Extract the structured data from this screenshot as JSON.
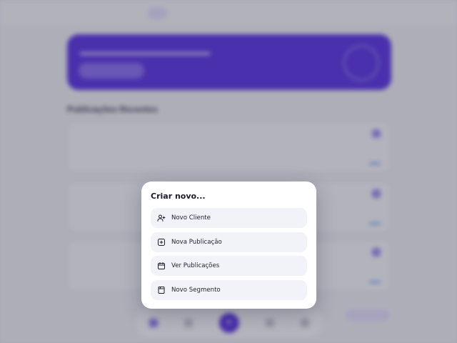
{
  "modal": {
    "title": "Criar novo...",
    "options": [
      {
        "label": "Novo Cliente",
        "icon": "user-plus-icon"
      },
      {
        "label": "Nova Publicação",
        "icon": "plus-square-icon"
      },
      {
        "label": "Ver Publicações",
        "icon": "calendar-icon"
      },
      {
        "label": "Novo Segmento",
        "icon": "book-icon"
      }
    ]
  },
  "background": {
    "section_title": "Publicações Recentes"
  },
  "colors": {
    "accent": "#5b35e3",
    "modal_bg": "#ffffff",
    "option_bg": "#f2f3f8"
  }
}
